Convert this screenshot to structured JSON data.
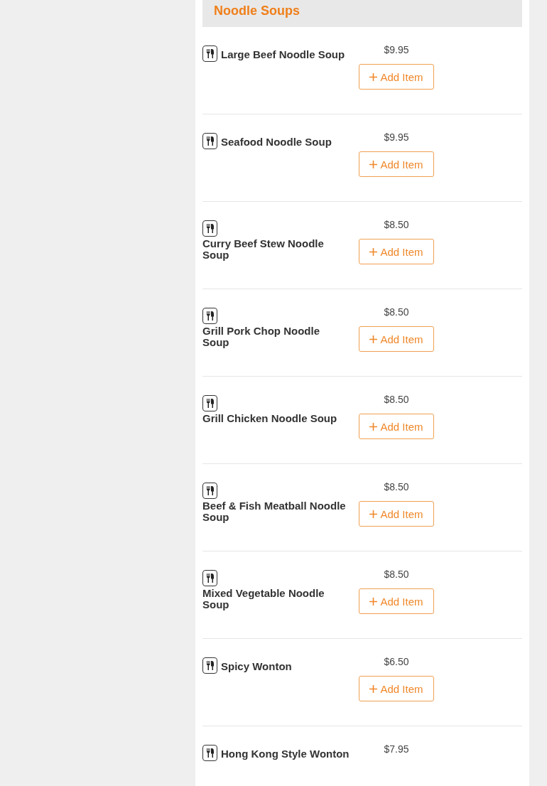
{
  "section": {
    "title": "Noodle Soups"
  },
  "items": [
    {
      "name": "Large Beef Noodle Soup",
      "price": "$9.95",
      "button": "Add Item"
    },
    {
      "name": "Seafood Noodle Soup",
      "price": "$9.95",
      "button": "Add Item"
    },
    {
      "name": "Curry Beef Stew Noodle Soup",
      "price": "$8.50",
      "button": "Add Item"
    },
    {
      "name": "Grill Pork Chop Noodle Soup",
      "price": "$8.50",
      "button": "Add Item"
    },
    {
      "name": "Grill Chicken Noodle Soup",
      "price": "$8.50",
      "button": "Add Item"
    },
    {
      "name": "Beef & Fish Meatball Noodle Soup",
      "price": "$8.50",
      "button": "Add Item"
    },
    {
      "name": "Mixed Vegetable Noodle Soup",
      "price": "$8.50",
      "button": "Add Item"
    },
    {
      "name": "Spicy Wonton",
      "price": "$6.50",
      "button": "Add Item"
    },
    {
      "name": "Hong Kong Style Wonton",
      "price": "$7.95"
    }
  ]
}
